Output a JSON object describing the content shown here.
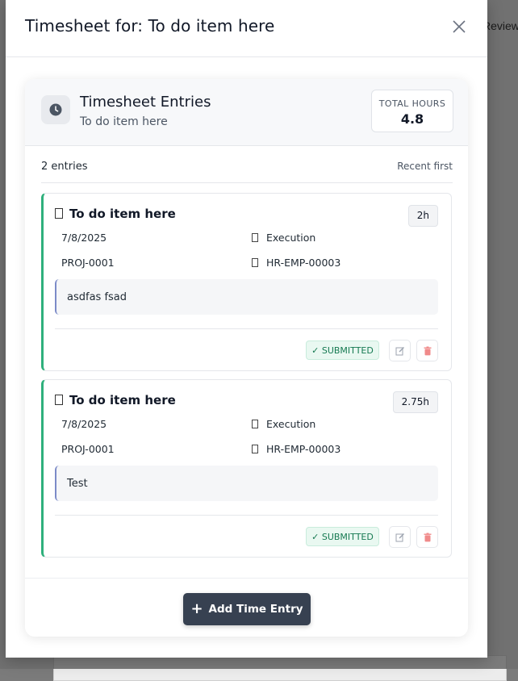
{
  "background": {
    "header_fragment": "Review"
  },
  "modal": {
    "title": "Timesheet for: To do item here"
  },
  "panel": {
    "title": "Timesheet Entries",
    "subtitle": "To do item here",
    "total_hours_label": "TOTAL HOURS",
    "total_hours_value": "4.8",
    "entry_count": "2 entries",
    "sort_label": "Recent first"
  },
  "entries": [
    {
      "title": "To do item here",
      "hours": "2h",
      "date": "7/8/2025",
      "phase": "Execution",
      "project": "PROJ-0001",
      "employee": "HR-EMP-00003",
      "note": "asdfas fsad",
      "status": "✓ SUBMITTED"
    },
    {
      "title": "To do item here",
      "hours": "2.75h",
      "date": "7/8/2025",
      "phase": "Execution",
      "project": "PROJ-0001",
      "employee": "HR-EMP-00003",
      "note": "Test",
      "status": "✓ SUBMITTED"
    }
  ],
  "footer": {
    "add_label": "Add Time Entry"
  },
  "colors": {
    "accent_green": "#2fb07c",
    "primary_button": "#374151",
    "status_text": "#167a52",
    "delete_red": "#f08a8a"
  },
  "icons": {
    "close": "close-icon",
    "clock": "clock-icon",
    "edit": "edit-icon",
    "delete": "trash-icon",
    "add": "plus-icon"
  }
}
